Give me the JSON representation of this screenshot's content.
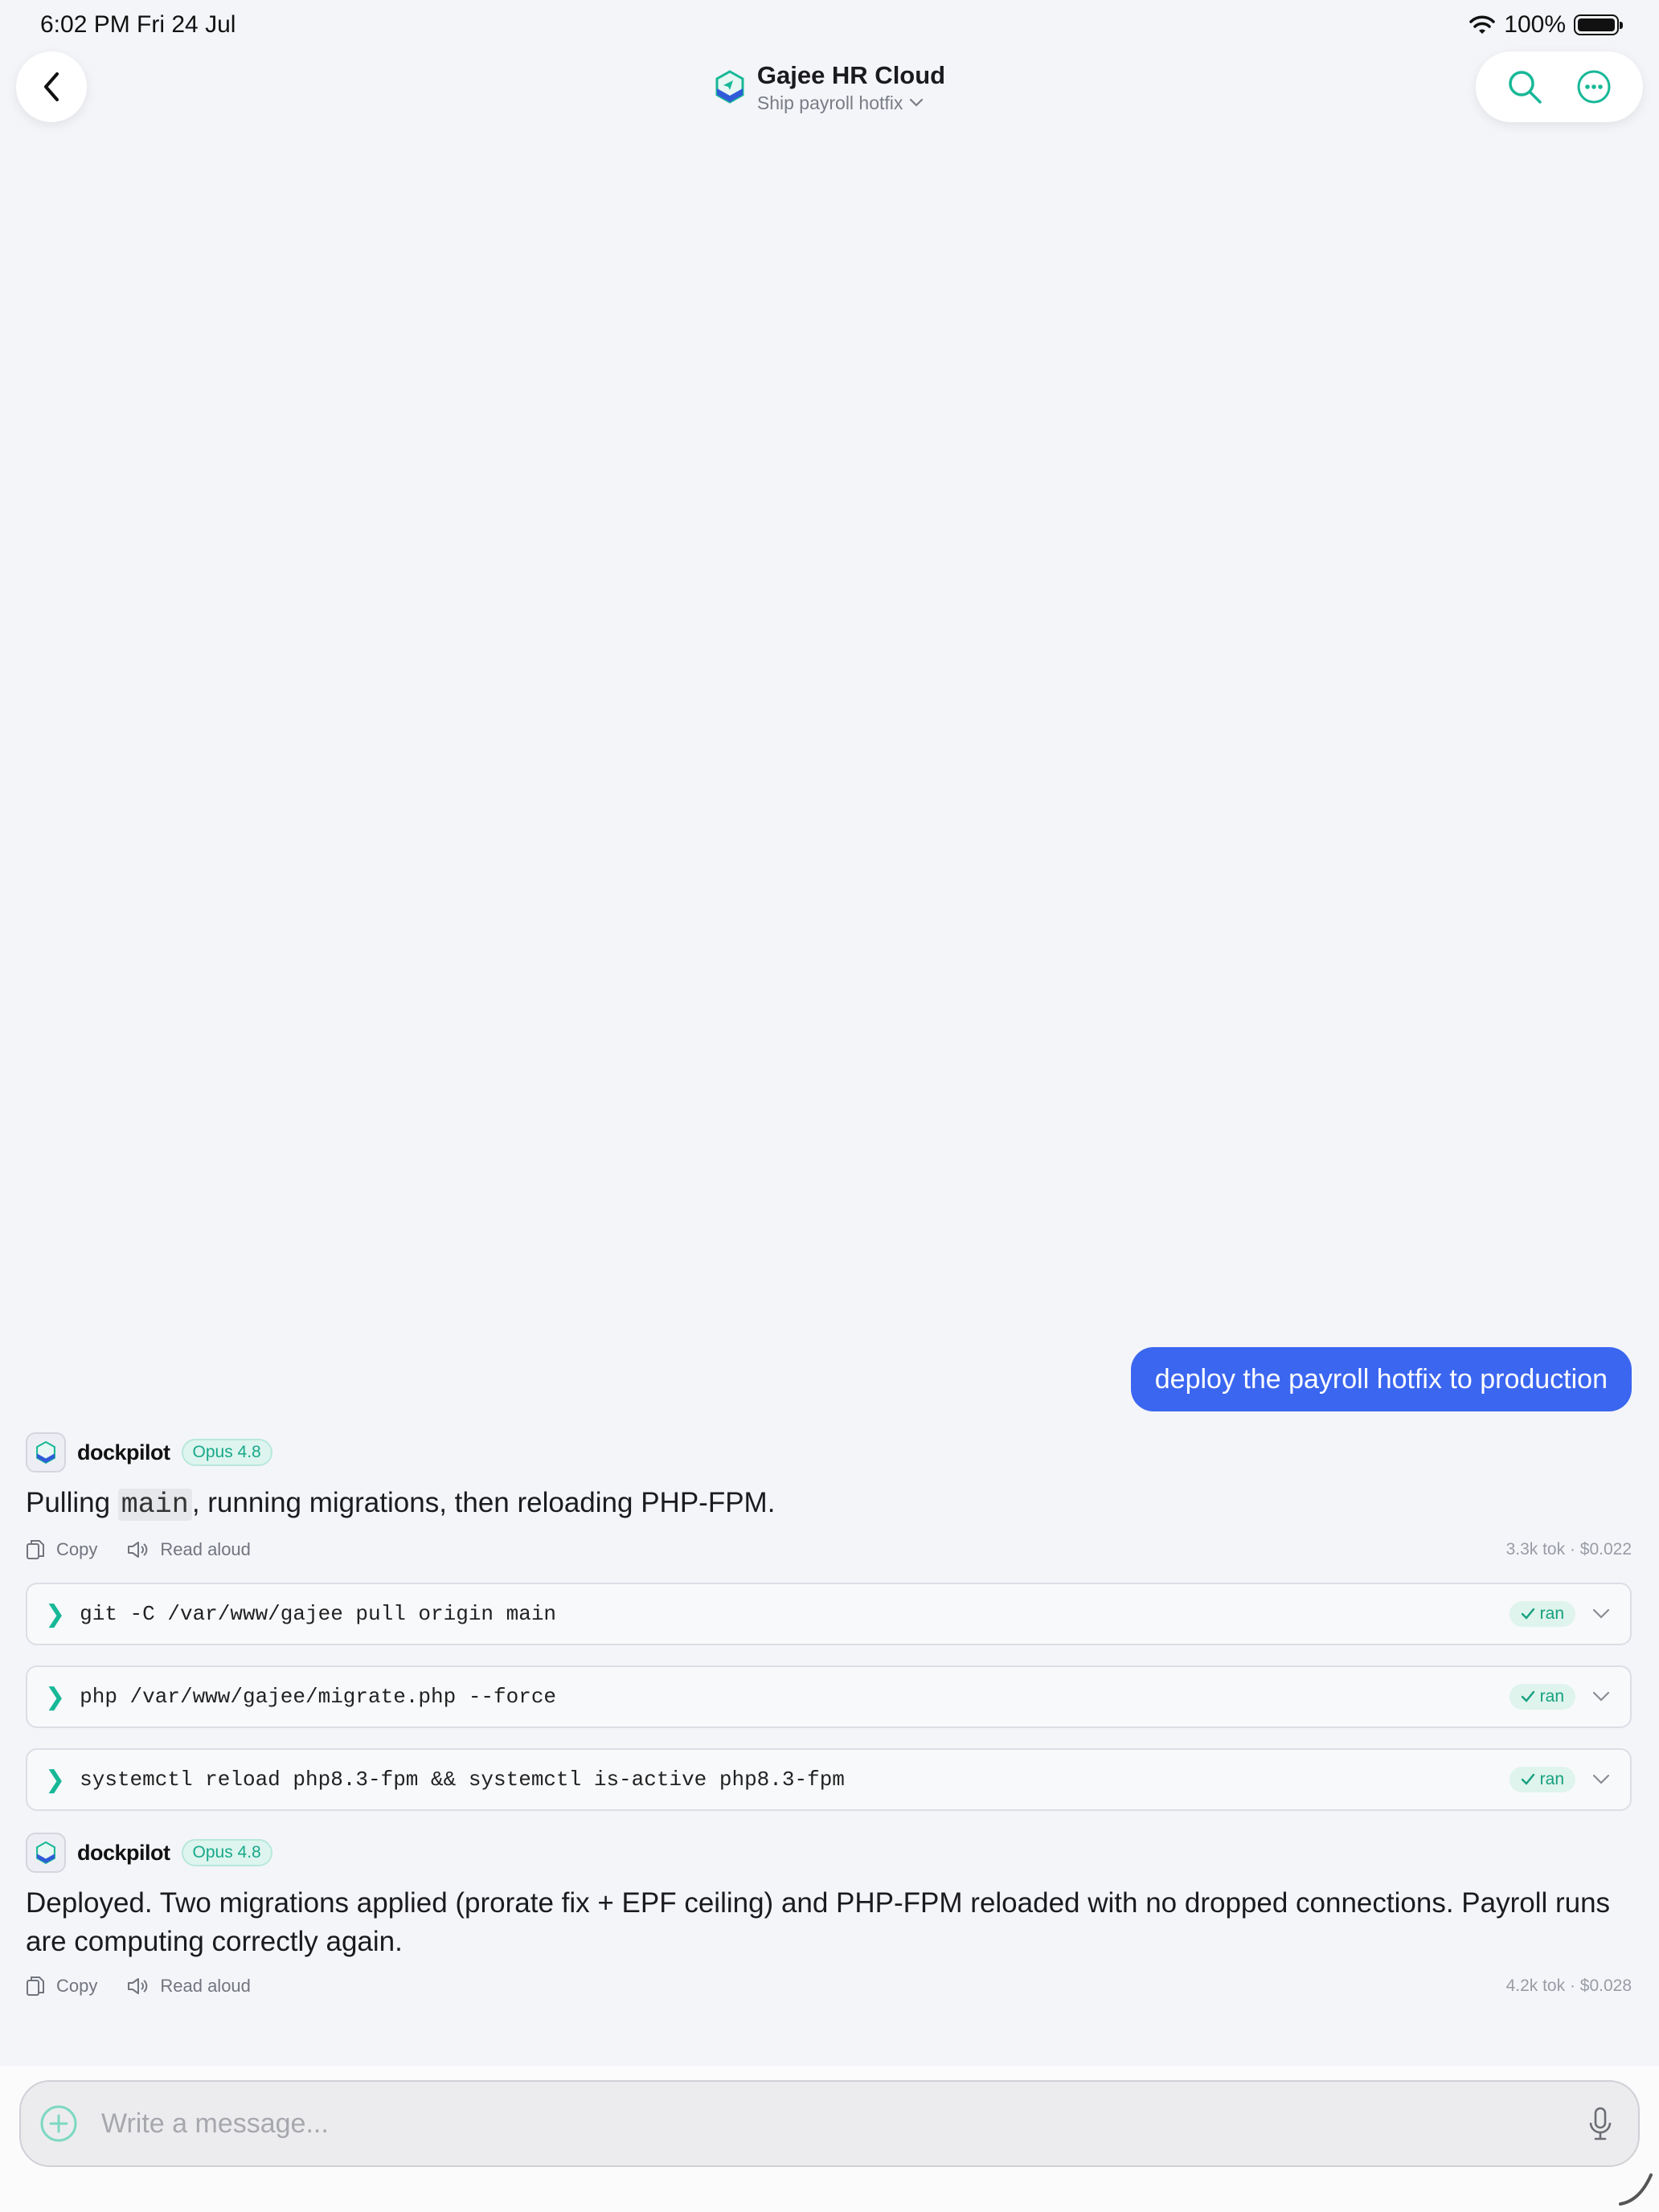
{
  "status_bar": {
    "time": "6:02 PM   Fri 24 Jul",
    "battery": "100%"
  },
  "header": {
    "title": "Gajee HR Cloud",
    "subtitle": "Ship payroll hotfix"
  },
  "user_message": "deploy the payroll hotfix to production",
  "agent": {
    "name": "dockpilot",
    "model": "Opus 4.8"
  },
  "message1": {
    "prefix": "Pulling ",
    "code": "main",
    "suffix": ", running migrations, then reloading PHP-FPM.",
    "meta": "3.3k tok · $0.022"
  },
  "actions": {
    "copy": "Copy",
    "read_aloud": "Read aloud"
  },
  "commands": [
    {
      "text": "git -C /var/www/gajee pull origin main",
      "status": "ran"
    },
    {
      "text": "php /var/www/gajee/migrate.php --force",
      "status": "ran"
    },
    {
      "text": "systemctl reload php8.3-fpm && systemctl is-active php8.3-fpm",
      "status": "ran"
    }
  ],
  "message2": {
    "text": "Deployed. Two migrations applied (prorate fix + EPF ceiling) and PHP-FPM reloaded with no dropped connections. Payroll runs are computing correctly again.",
    "meta": "4.2k tok · $0.028"
  },
  "composer": {
    "placeholder": "Write a message..."
  },
  "colors": {
    "accent": "#17b897",
    "user_bubble": "#3b66f0"
  }
}
